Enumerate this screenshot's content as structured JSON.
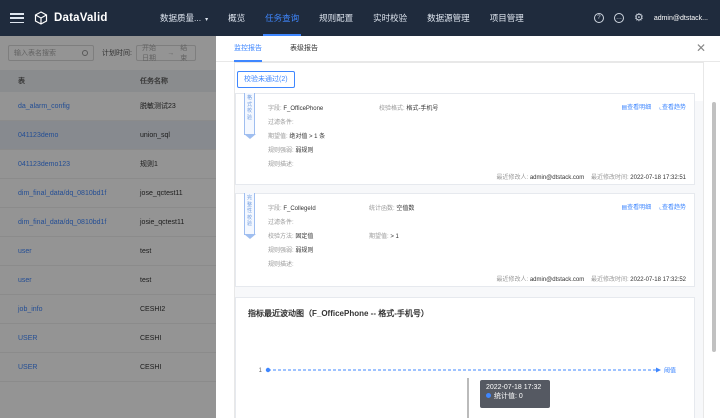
{
  "app": {
    "name": "DataValid"
  },
  "nav": {
    "items": [
      {
        "label": "数据质量...",
        "caret": "▾"
      },
      {
        "label": "概览"
      },
      {
        "label": "任务查询"
      },
      {
        "label": "规则配置"
      },
      {
        "label": "实时校验"
      },
      {
        "label": "数据源管理"
      },
      {
        "label": "项目管理"
      }
    ],
    "active_index": 2,
    "user": "admin@dtstack..."
  },
  "filters": {
    "search_placeholder": "输入表名搜索",
    "plan_time_label": "计划时间:",
    "start_placeholder": "开始日期",
    "end_placeholder": "结束"
  },
  "table": {
    "headers": [
      "表",
      "任务名称"
    ],
    "rows": [
      {
        "table": "da_alarm_config",
        "task": "脱敏测试23"
      },
      {
        "table": "041123demo",
        "task": "union_sql"
      },
      {
        "table": "041123demo123",
        "task": "规则1"
      },
      {
        "table": "dim_final_data/dq_0810bd1f",
        "task": "jose_qctest11"
      },
      {
        "table": "dim_final_data/dq_0810bd1f",
        "task": "josie_qctest11"
      },
      {
        "table": "user",
        "task": "test"
      },
      {
        "table": "user",
        "task": "test"
      },
      {
        "table": "job_info",
        "task": "CESHI2"
      },
      {
        "table": "USER",
        "task": "CESHI"
      },
      {
        "table": "USER",
        "task": "CESHI"
      }
    ]
  },
  "drawer": {
    "tabs": [
      "监控报告",
      "表级报告"
    ],
    "active_tab": 0,
    "fail_button": "校验未通过(2)",
    "cards": [
      {
        "tag": "格式校验",
        "field_label": "字段:",
        "field_value": "F_OfficePhone",
        "second_label": "校验格式:",
        "second_value": "格式-手机号",
        "row2_label": "过滤条件:",
        "row2_value": "",
        "row3_label": "期望值:",
        "row3_value": "绝对值 > 1 条",
        "row4_label": "规则强弱:",
        "row4_value": "弱规则",
        "row5_label": "规则描述:",
        "row5_value": "",
        "action1": "查看明细",
        "action2": "查看趋势",
        "modifier_label": "最近修改人:",
        "modifier": "admin@dtstack.com",
        "time_label": "最近修改时间:",
        "time": "2022-07-18 17:32:51"
      },
      {
        "tag": "完整性校验",
        "field_label": "字段:",
        "field_value": "F_CollegeId",
        "second_label": "统计函数:",
        "second_value": "空值数",
        "row2_label": "过滤条件:",
        "row2_value": "",
        "row3_label": "校验方法:",
        "row3_value": "固定值",
        "row3b_label": "期望值:",
        "row3b_value": "> 1",
        "row4_label": "规则强弱:",
        "row4_value": "弱规则",
        "row5_label": "规则描述:",
        "row5_value": "",
        "action1": "查看明细",
        "action2": "查看趋势",
        "modifier_label": "最近修改人:",
        "modifier": "admin@dtstack.com",
        "time_label": "最近修改时间:",
        "time": "2022-07-18 17:32:52"
      }
    ],
    "chart": {
      "title": "指标最近波动图（F_OfficePhone -- 格式-手机号）",
      "tooltip_time": "2022-07-18 17:32",
      "tooltip_label": "统计值:",
      "tooltip_value": "0"
    }
  },
  "chart_data": {
    "type": "line",
    "title": "指标最近波动图（F_OfficePhone -- 格式-手机号）",
    "x": [
      "2022-07-18 17:32"
    ],
    "series": [
      {
        "name": "阈值",
        "values": [
          1
        ],
        "style": "dashed"
      },
      {
        "name": "统计值",
        "values": [
          0
        ]
      }
    ],
    "tick_labels_y": [
      "1"
    ],
    "legend": "right",
    "colors": {
      "accent": "#3f87ff"
    }
  },
  "colors": {
    "nav_bg": "#1f2b3d",
    "accent": "#3f87ff"
  }
}
